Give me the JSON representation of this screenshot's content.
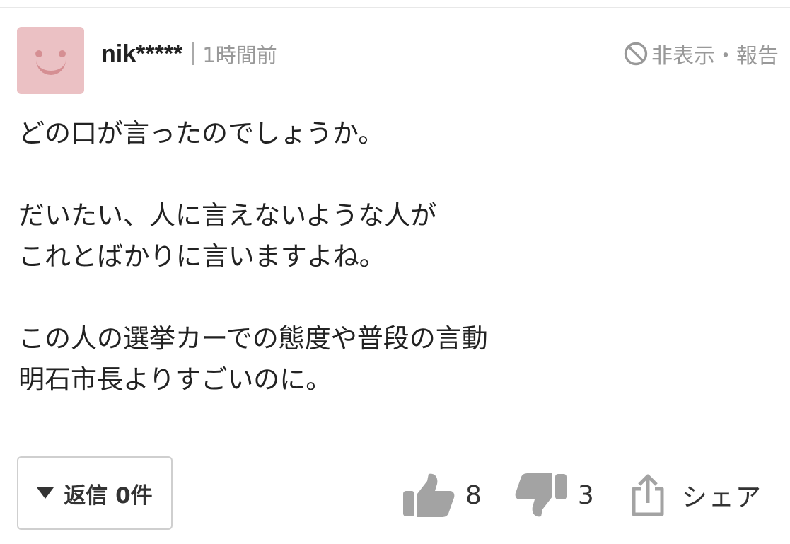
{
  "comment": {
    "user_name": "nik*****",
    "timestamp": "1時間前",
    "hide_report_label": "非表示・報告",
    "body": "どの口が言ったのでしょうか。\n\nだいたい、人に言えないような人が\nこれとばかりに言いますよね。\n\nこの人の選挙カーでの態度や普段の言動\n明石市長よりすごいのに。",
    "reply_button_label": "返信 0件",
    "likes": "8",
    "dislikes": "3",
    "share_label": "シェア"
  },
  "icons": {
    "avatar": "smiley-avatar",
    "hide": "prohibit-icon",
    "reply": "triangle-down-icon",
    "like": "thumbs-up-icon",
    "dislike": "thumbs-down-icon",
    "share": "share-icon"
  },
  "colors": {
    "avatar_bg": "#ebc1c4",
    "avatar_face": "#d58f93",
    "muted_text": "#999999",
    "icon_gray": "#a3a3a3"
  }
}
